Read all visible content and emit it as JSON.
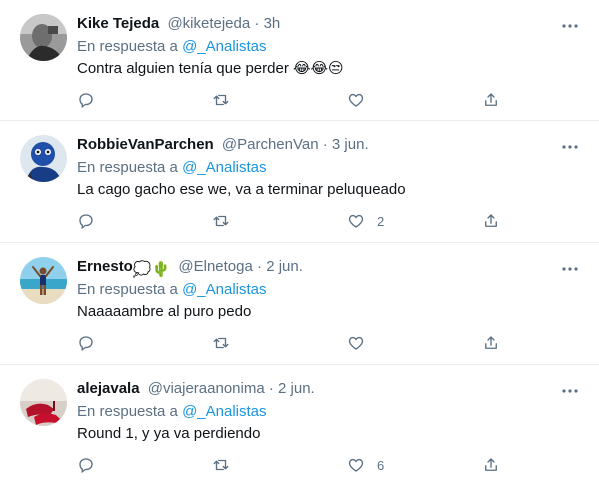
{
  "tweets": [
    {
      "name": "Kike Tejeda",
      "handle": "@kiketejeda",
      "dot": "·",
      "time": "3h",
      "reply_prefix": "En respuesta a",
      "reply_mention": "@_Analistas",
      "text": "Contra alguien tenía que perder 😂😂😒",
      "like_count": "",
      "reply_count": ""
    },
    {
      "name": "RobbieVanParchen",
      "handle": "@ParchenVan",
      "dot": "·",
      "time": "3 jun.",
      "reply_prefix": "En respuesta a",
      "reply_mention": "@_Analistas",
      "text": "La cago gacho ese we, va a terminar peluqueado",
      "like_count": "2"
    },
    {
      "name": "Ernesto",
      "name_emojis": "💭🌵",
      "handle": "@Elnetoga",
      "dot": "·",
      "time": "2 jun.",
      "reply_prefix": "En respuesta a",
      "reply_mention": "@_Analistas",
      "text": "Naaaaambre al puro pedo",
      "like_count": ""
    },
    {
      "name": "alejavala",
      "handle": "@viajeraanonima",
      "dot": "·",
      "time": "2 jun.",
      "reply_prefix": "En respuesta a",
      "reply_mention": "@_Analistas",
      "text": "Round 1, y ya va perdiendo",
      "like_count": "6"
    }
  ],
  "colors": {
    "mention": "#1b95e0",
    "muted": "#5b7083",
    "text": "#0f1419",
    "divider": "#e6ecf0"
  },
  "icons": [
    "reply-icon",
    "retweet-icon",
    "like-icon",
    "share-icon",
    "more-icon"
  ]
}
